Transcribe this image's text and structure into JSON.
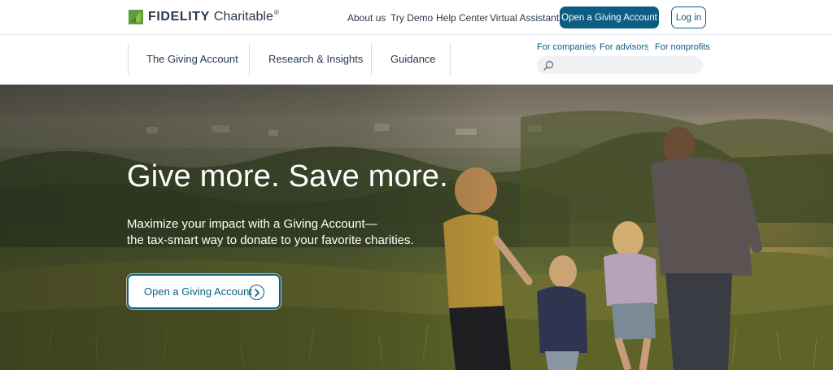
{
  "brand": {
    "name": "FIDELITY",
    "product": "Charitable",
    "reg": "®"
  },
  "utility_nav": [
    {
      "label": "About us"
    },
    {
      "label": "Try Demo"
    },
    {
      "label": "Help Center"
    },
    {
      "label": "Virtual Assistant"
    }
  ],
  "header_buttons": {
    "open_account": "Open a Giving Account",
    "login": "Log in"
  },
  "main_nav": [
    {
      "label": "The Giving Account"
    },
    {
      "label": "Research & Insights"
    },
    {
      "label": "Guidance"
    }
  ],
  "audience_links": [
    {
      "label": "For companies"
    },
    {
      "label": "For advisors"
    },
    {
      "label": "For nonprofits"
    }
  ],
  "search": {
    "value": "",
    "placeholder": ""
  },
  "hero": {
    "title": "Give more. Save more.",
    "subtitle_line1": "Maximize your impact with a Giving Account—",
    "subtitle_line2": "the tax-smart way to donate to your favorite charities.",
    "cta_label": "Open a Giving Account"
  },
  "colors": {
    "brand_blue": "#0b5d82",
    "logo_green": "#5f9e3c",
    "text_dark": "#28394b"
  },
  "icons": [
    "fidelity-logo-mark-icon",
    "search-icon",
    "chevron-right-icon"
  ]
}
